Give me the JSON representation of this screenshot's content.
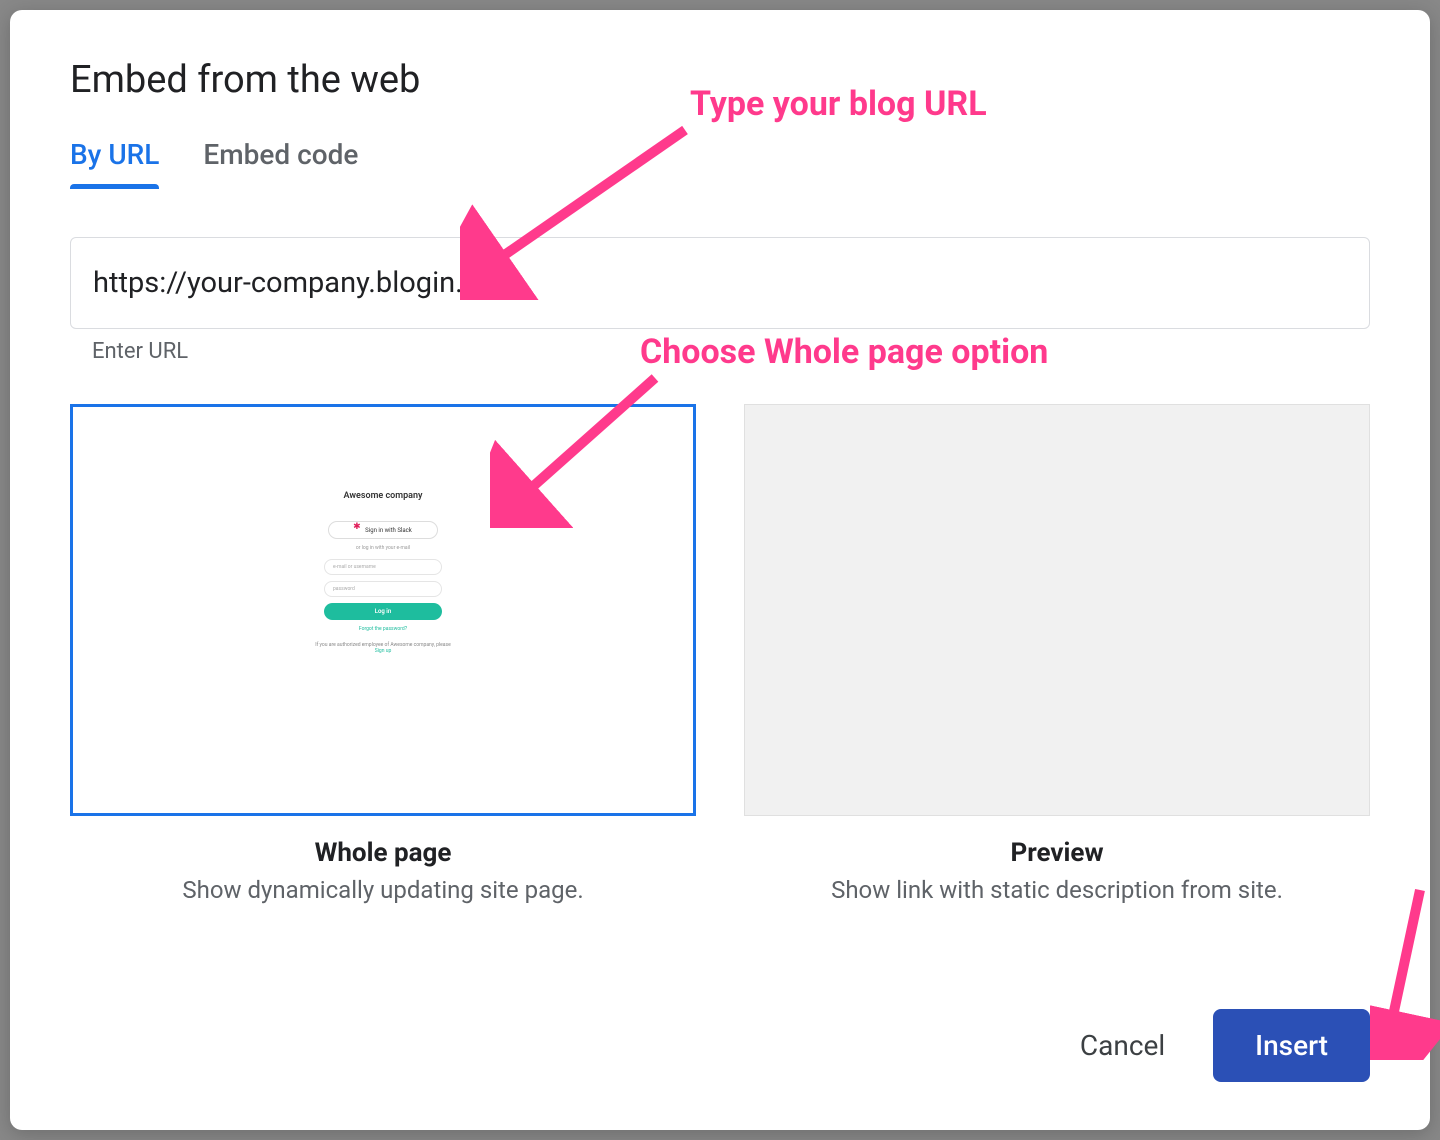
{
  "dialog": {
    "title": "Embed from the web",
    "tabs": {
      "by_url": "By URL",
      "embed_code": "Embed code"
    },
    "url_input": {
      "value": "https://your-company.blogin.co",
      "helper": "Enter URL"
    },
    "options": {
      "whole_page": {
        "title": "Whole page",
        "subtitle": "Show dynamically updating site page.",
        "mock": {
          "company": "Awesome company",
          "slack_button": "Sign in with Slack",
          "or_text": "or log in with your e-mail",
          "email_placeholder": "e-mail or username",
          "password_placeholder": "password",
          "login_button": "Log in",
          "forgot": "Forgot the password?",
          "footer_prefix": "If you are authorized employee of Awesome company, please ",
          "footer_link": "Sign up"
        }
      },
      "preview": {
        "title": "Preview",
        "subtitle": "Show link with static description from site."
      }
    },
    "actions": {
      "cancel": "Cancel",
      "insert": "Insert"
    }
  },
  "annotations": {
    "type_url": "Type your blog URL",
    "choose_option": "Choose Whole page option"
  }
}
